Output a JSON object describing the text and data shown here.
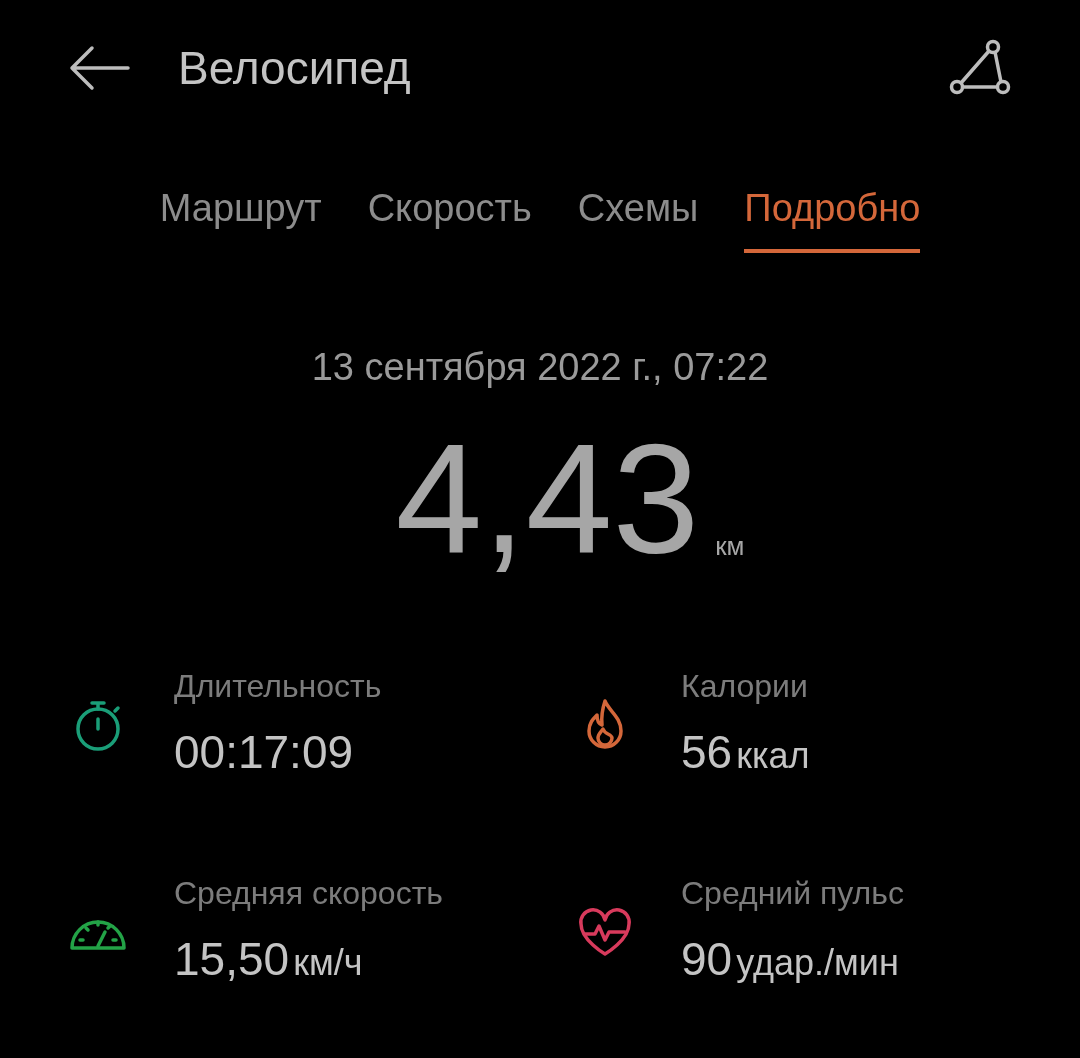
{
  "header": {
    "title": "Велосипед"
  },
  "tabs": [
    {
      "label": "Маршрут",
      "selected": false
    },
    {
      "label": "Скорость",
      "selected": false
    },
    {
      "label": "Схемы",
      "selected": false
    },
    {
      "label": "Подробно",
      "selected": true
    }
  ],
  "summary": {
    "date": "13 сентября 2022 г., 07:22",
    "distance": "4,43",
    "unit": "км"
  },
  "stats": [
    {
      "kind": "duration",
      "color": "#1a9e78",
      "label": "Длительность",
      "value": "00:17:09"
    },
    {
      "kind": "calories",
      "color": "#d4673a",
      "label": "Калории",
      "value": "56",
      "unit": "ккал"
    },
    {
      "kind": "speed",
      "color": "#23a347",
      "label": "Средняя скорость",
      "value": "15,50",
      "unit": "км/ч"
    },
    {
      "kind": "pulse",
      "color": "#d83a5c",
      "label": "Средний пульс",
      "value": "90",
      "unit": "удар./мин"
    }
  ]
}
